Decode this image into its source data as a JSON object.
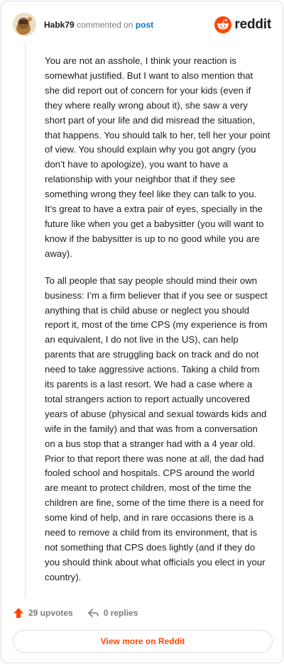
{
  "header": {
    "username": "Habk79",
    "verb": "commented on",
    "post_link": "post",
    "brand": "reddit"
  },
  "comment": {
    "paragraphs": [
      "You are not an asshole, I think your reaction is somewhat justified. But I want to also mention that she did report out of concern for your kids (even if they where really wrong about it), she saw a very short part of your life and did misread the situation, that happens. You should talk to her, tell her your point of view. You should explain why you got angry (you don’t have to apologize), you want to have a relationship with your neighbor that if they see something wrong they feel like they can talk to you. It’s great to have a extra pair of eyes, specially in the future like when you get a babysitter (you will want to know if the babysitter is up to no good while you are away).",
      "To all people that say people should mind their own business: I’m a firm believer that if you see or suspect anything that is child abuse or neglect you should report it, most of the time CPS (my experience is from an equivalent, I do not live in the US), can help parents that are struggling back on track and do not need to take aggressive actions. Taking a child from its parents is a last resort. We had a case where a total strangers action to report actually uncovered years of abuse (physical and sexual towards kids and wife in the family) and that was from a conversation on a bus stop that a stranger had with a 4 year old. Prior to that report there was none at all, the dad had fooled school and hospitals. CPS around the world are meant to protect children, most of the time the children are fine, some of the time there is a need for some kind of help, and in rare occasions there is a need to remove a child from its environment, that is not something that CPS does lightly (and if they do you should think about what officials you elect in your country)."
    ]
  },
  "actions": {
    "upvotes": "29 upvotes",
    "replies": "0 replies"
  },
  "footer": {
    "view_more": "View more on Reddit"
  },
  "colors": {
    "accent": "#ff4500",
    "link": "#0079d3",
    "muted": "#7c7c7c"
  }
}
